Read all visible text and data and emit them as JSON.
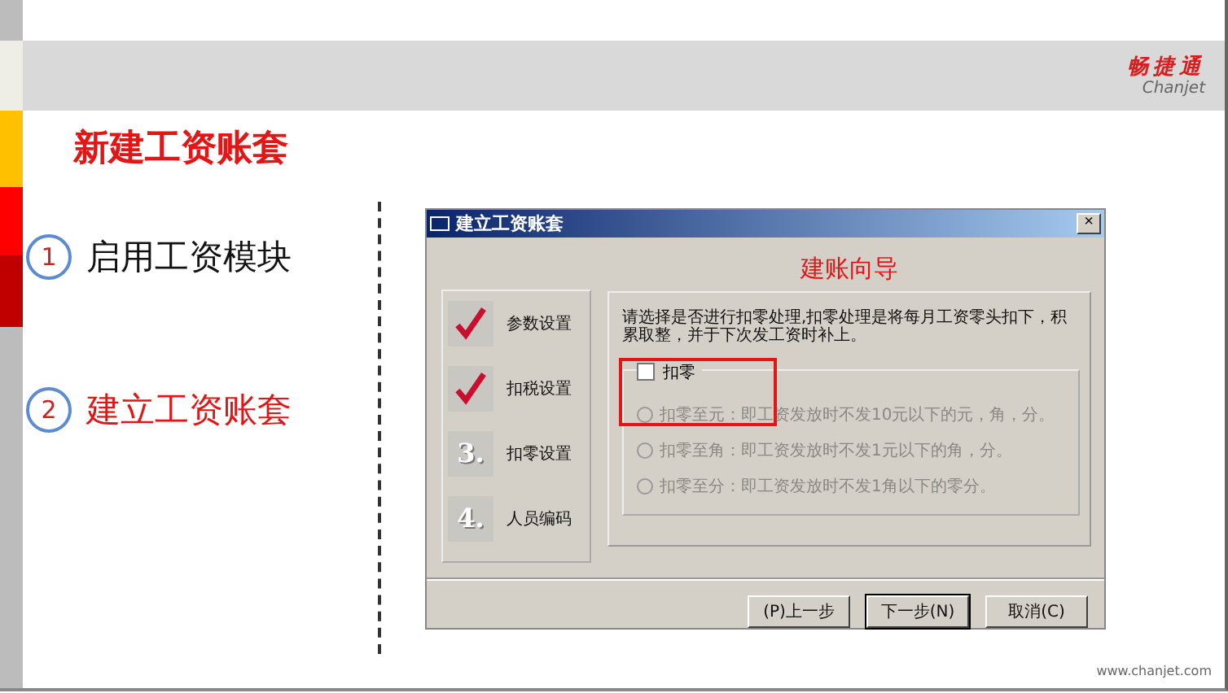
{
  "logo": {
    "name": "畅捷通",
    "latin": "Chanjet"
  },
  "title": "新建工资账套",
  "steps": [
    {
      "number": "1",
      "label": "启用工资模块",
      "selected": false
    },
    {
      "number": "2",
      "label": "建立工资账套",
      "selected": true
    }
  ],
  "dialog": {
    "title": "建立工资账套",
    "close": "×",
    "heading": "建账向导",
    "wizard_steps": [
      {
        "kind": "done",
        "label": "参数设置"
      },
      {
        "kind": "done",
        "label": "扣税设置"
      },
      {
        "kind": "number",
        "number": "3.",
        "label": "扣零设置"
      },
      {
        "kind": "number",
        "number": "4.",
        "label": "人员编码"
      }
    ],
    "description": "请选择是否进行扣零处理,扣零处理是将每月工资零头扣下，积累取整，并于下次发工资时补上。",
    "checkbox": {
      "label": "扣零",
      "checked": false
    },
    "options": [
      {
        "label": "扣零至元：即工资发放时不发10元以下的元，角，分。",
        "selected": false,
        "disabled": true
      },
      {
        "label": "扣零至角：即工资发放时不发1元以下的角，分。",
        "selected": false,
        "disabled": true
      },
      {
        "label": "扣零至分：即工资发放时不发1角以下的零分。",
        "selected": false,
        "disabled": true
      }
    ],
    "buttons": [
      {
        "label": "(P)上一步",
        "default": false
      },
      {
        "label": "下一步(N)",
        "default": true
      },
      {
        "label": "取消(C)",
        "default": false
      }
    ]
  },
  "footer": "www.chanjet.com"
}
